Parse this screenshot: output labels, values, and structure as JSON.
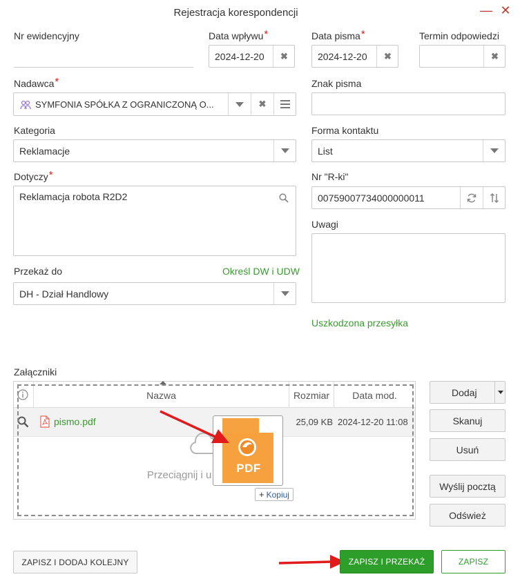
{
  "dialog": {
    "title": "Rejestracja korespondencji",
    "minimize_glyph": "—",
    "close_glyph": "✕"
  },
  "form": {
    "nr_ewidencyjny": {
      "label": "Nr ewidencyjny",
      "value": ""
    },
    "data_wplywu": {
      "label": "Data wpływu",
      "value": "2024-12-20",
      "required": "*"
    },
    "data_pisma": {
      "label": "Data pisma",
      "value": "2024-12-20",
      "required": "*"
    },
    "termin_odpowiedzi": {
      "label": "Termin odpowiedzi",
      "value": ""
    },
    "nadawca": {
      "label": "Nadawca",
      "value": "SYMFONIA SPÓŁKA Z OGRANICZONĄ O...",
      "required": "*"
    },
    "znak_pisma": {
      "label": "Znak pisma",
      "value": ""
    },
    "kategoria": {
      "label": "Kategoria",
      "value": "Reklamacje"
    },
    "forma_kontaktu": {
      "label": "Forma kontaktu",
      "value": "List"
    },
    "dotyczy": {
      "label": "Dotyczy",
      "value": "Reklamacja robota R2D2",
      "required": "*"
    },
    "nr_rki": {
      "label": "Nr \"R-ki\"",
      "value": "00759007734000000011"
    },
    "uwagi": {
      "label": "Uwagi",
      "value": ""
    },
    "przekaz_do": {
      "label": "Przekaż do",
      "value": "DH - Dział Handlowy",
      "link": "Określ DW i UDW"
    },
    "uszkodzona_link": "Uszkodzona przesyłka"
  },
  "attachments": {
    "label": "Załączniki",
    "columns": [
      "Nazwa",
      "Rozmiar",
      "Data mod."
    ],
    "rows": [
      {
        "name": "pismo.pdf",
        "size": "25,09 KB",
        "date": "2024-12-20 11:08"
      }
    ],
    "drop_hint": "Przeciągnij i u",
    "drag_badge": "PDF",
    "copy_tooltip": "Kopiuj",
    "copy_plus": "+"
  },
  "side_buttons": {
    "add": "Dodaj",
    "scan": "Skanuj",
    "remove": "Usuń",
    "send_mail": "Wyślij pocztą",
    "refresh": "Odśwież"
  },
  "footer": {
    "save_add": "ZAPISZ I DODAJ KOLEJNY",
    "save_forward": "ZAPISZ I PRZEKAŻ",
    "save": "ZAPISZ"
  },
  "colors": {
    "accent_green": "#3a9a2f",
    "primary_button": "#2e9e2a",
    "required_star": "#e0201c",
    "arrow_red": "#e01b1b"
  }
}
